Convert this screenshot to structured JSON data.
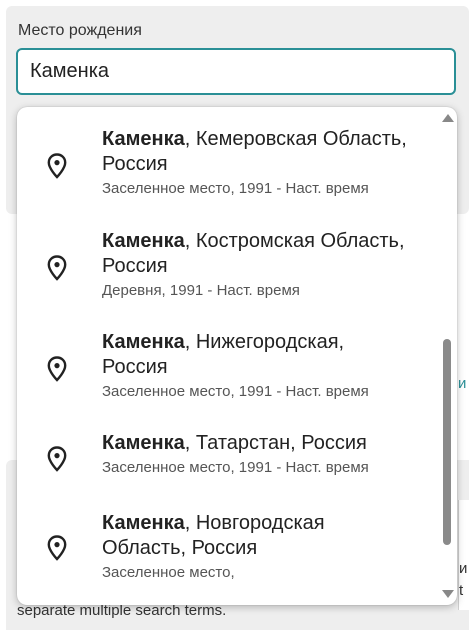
{
  "field": {
    "label": "Место рождения",
    "value": "Каменка"
  },
  "background": {
    "peek_teal": "и",
    "peek_1": "и",
    "peek_2": "t",
    "hint_text": "separate multiple search terms."
  },
  "suggestions": [
    {
      "name": "Каменка",
      "region_line1": ", Кемеровская Область,",
      "region_line2": "Россия",
      "meta": "Заселенное место, 1991 - Наст. время"
    },
    {
      "name": "Каменка",
      "region_line1": ", Костромская Область,",
      "region_line2": "Россия",
      "meta": "Деревня, 1991 - Наст. время"
    },
    {
      "name": "Каменка",
      "region_line1": ", Нижегородская,",
      "region_line2": "Россия",
      "meta": "Заселенное место, 1991 - Наст. время"
    },
    {
      "name": "Каменка",
      "region_line1": ", Татарстан, Россия",
      "region_line2": "",
      "meta": "Заселенное место, 1991 - Наст. время"
    },
    {
      "name": "Каменка",
      "region_line1": ", Новгородская",
      "region_line2": "Область, Россия",
      "meta": "Заселенное место,"
    }
  ],
  "icons": {
    "suggestion": "map-pin-icon",
    "scroll_up": "triangle-up-icon",
    "scroll_down": "triangle-down-icon"
  },
  "colors": {
    "accent": "#2a8f96",
    "background_card": "#eeeeee",
    "scrollbar": "#8a8a8a"
  }
}
